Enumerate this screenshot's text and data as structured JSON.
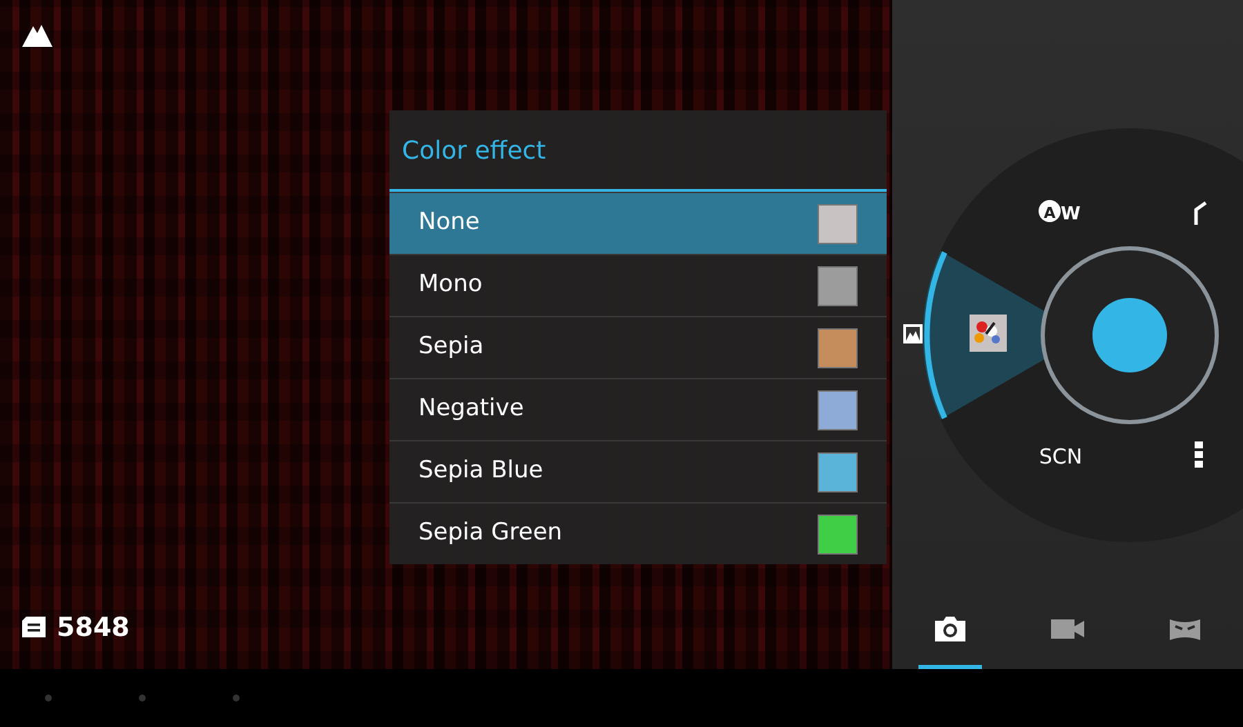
{
  "counter": {
    "text": "5848"
  },
  "menu": {
    "title": "Color effect",
    "items": [
      {
        "label": "None",
        "selected": true,
        "color": "#c9c2c2"
      },
      {
        "label": "Mono",
        "selected": false,
        "color": "#9c9c9c"
      },
      {
        "label": "Sepia",
        "selected": false,
        "color": "#c58c5c"
      },
      {
        "label": "Negative",
        "selected": false,
        "color": "#8eaad6"
      },
      {
        "label": "Sepia Blue",
        "selected": false,
        "color": "#5ab3d9"
      },
      {
        "label": "Sepia Green",
        "selected": false,
        "color": "#3fce46"
      }
    ]
  },
  "dial": {
    "white_balance": {
      "badge": "A",
      "suffix": "W"
    },
    "scene": "SCN"
  },
  "modes": [
    {
      "kind": "photo",
      "selected": true
    },
    {
      "kind": "video",
      "selected": false
    },
    {
      "kind": "panorama",
      "selected": false
    }
  ]
}
